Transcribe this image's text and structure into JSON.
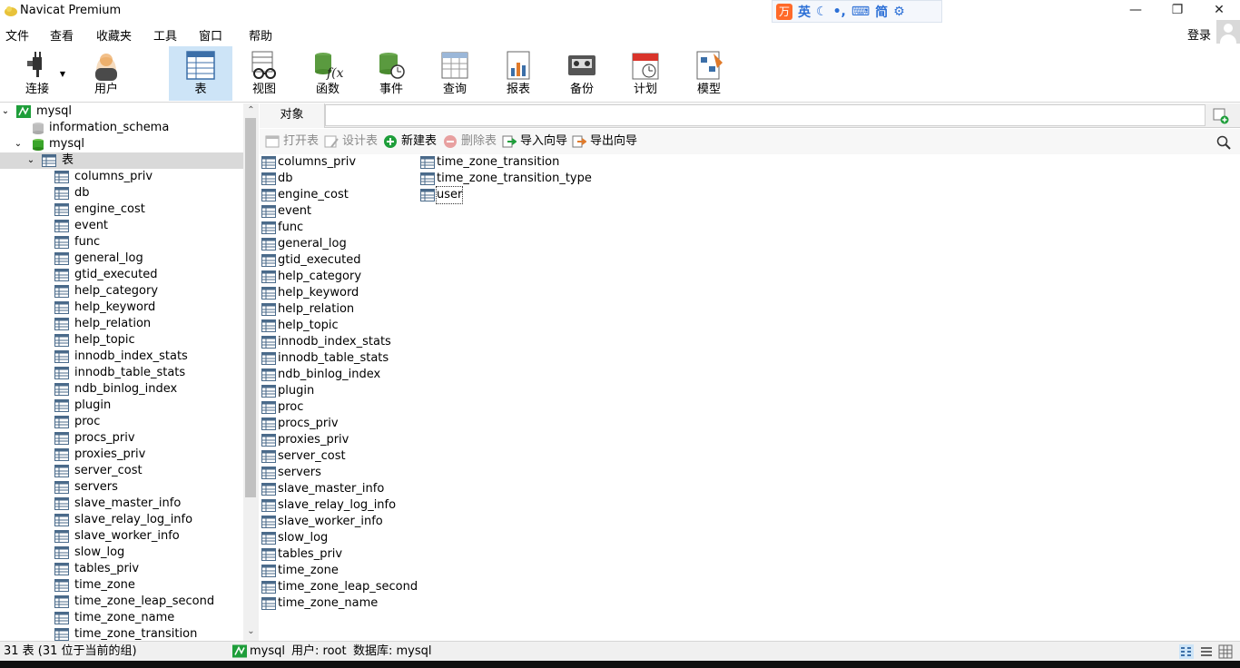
{
  "window": {
    "title": "Navicat Premium",
    "controls": [
      "minimize",
      "restore",
      "close"
    ]
  },
  "ime": {
    "items": [
      "英",
      "简"
    ]
  },
  "menu": [
    "文件",
    "查看",
    "收藏夹",
    "工具",
    "窗口",
    "帮助"
  ],
  "account": {
    "login_label": "登录"
  },
  "toolbar": [
    {
      "key": "connection",
      "label": "连接"
    },
    {
      "key": "user",
      "label": "用户"
    },
    {
      "key": "table",
      "label": "表",
      "active": true
    },
    {
      "key": "view",
      "label": "视图"
    },
    {
      "key": "function",
      "label": "函数"
    },
    {
      "key": "event",
      "label": "事件"
    },
    {
      "key": "query",
      "label": "查询"
    },
    {
      "key": "report",
      "label": "报表"
    },
    {
      "key": "backup",
      "label": "备份"
    },
    {
      "key": "schedule",
      "label": "计划"
    },
    {
      "key": "model",
      "label": "模型"
    }
  ],
  "tree": {
    "connection": "mysql",
    "databases": [
      "information_schema",
      "mysql"
    ],
    "tables_node": "表",
    "tables": [
      "columns_priv",
      "db",
      "engine_cost",
      "event",
      "func",
      "general_log",
      "gtid_executed",
      "help_category",
      "help_keyword",
      "help_relation",
      "help_topic",
      "innodb_index_stats",
      "innodb_table_stats",
      "ndb_binlog_index",
      "plugin",
      "proc",
      "procs_priv",
      "proxies_priv",
      "server_cost",
      "servers",
      "slave_master_info",
      "slave_relay_log_info",
      "slave_worker_info",
      "slow_log",
      "tables_priv",
      "time_zone",
      "time_zone_leap_second",
      "time_zone_name",
      "time_zone_transition"
    ]
  },
  "tabs": {
    "objects_label": "对象"
  },
  "object_toolbar": {
    "open": "打开表",
    "design": "设计表",
    "new": "新建表",
    "delete": "删除表",
    "import": "导入向导",
    "export": "导出向导"
  },
  "objects": {
    "column1": [
      "columns_priv",
      "db",
      "engine_cost",
      "event",
      "func",
      "general_log",
      "gtid_executed",
      "help_category",
      "help_keyword",
      "help_relation",
      "help_topic",
      "innodb_index_stats",
      "innodb_table_stats",
      "ndb_binlog_index",
      "plugin",
      "proc",
      "procs_priv",
      "proxies_priv",
      "server_cost",
      "servers",
      "slave_master_info",
      "slave_relay_log_info",
      "slave_worker_info",
      "slow_log",
      "tables_priv",
      "time_zone",
      "time_zone_leap_second",
      "time_zone_name"
    ],
    "column2": [
      "time_zone_transition",
      "time_zone_transition_type",
      "user"
    ]
  },
  "status": {
    "count": "31 表 (31 位于当前的组)",
    "connection": "mysql",
    "user": "用户: root",
    "database": "数据库: mysql"
  },
  "colors": {
    "active_tool": "#cde4f7",
    "accent_green": "#1e9e3a"
  }
}
